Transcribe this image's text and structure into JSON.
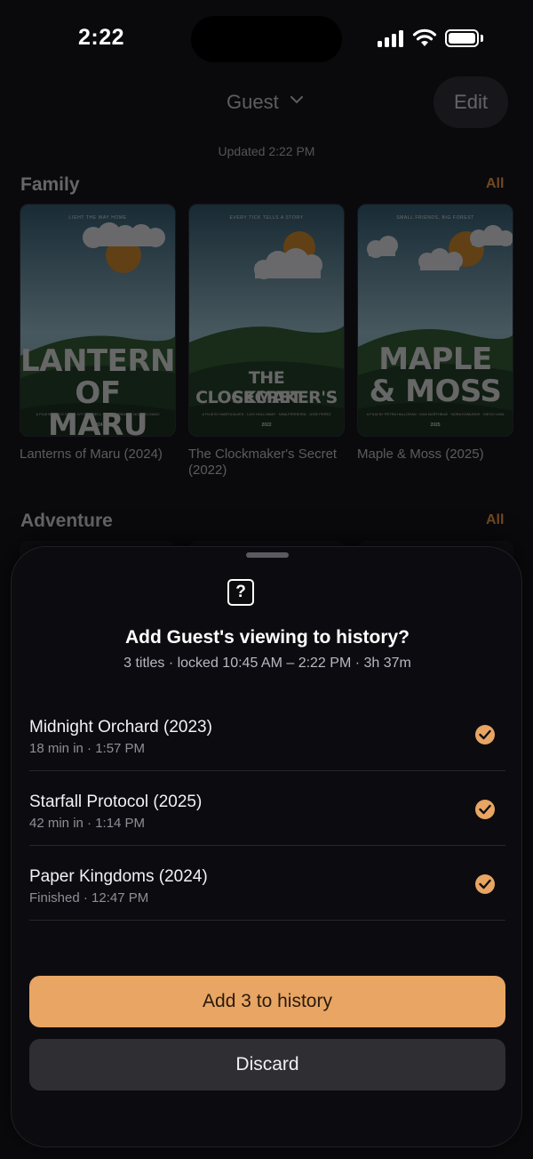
{
  "status_bar": {
    "time": "2:22"
  },
  "header": {
    "profile": "Guest",
    "edit_label": "Edit",
    "updated": "Updated 2:22 PM"
  },
  "sections": [
    {
      "title": "Family",
      "all_label": "All",
      "posters": [
        {
          "tagline": "LIGHT THE WAY HOME",
          "title_line1": "LANTERNS",
          "title_line2": "OF MARU",
          "credits": "A FILM BY HAYO SATO · IVY ROSWELL · OAK FAIRBURY · NOA DELGADO",
          "year": "2024",
          "caption": "Lanterns of Maru (2024)"
        },
        {
          "tagline": "EVERY TICK TELLS A STORY",
          "title_line1": "THE CLOCKMAKER'S",
          "title_line2": "SECRET",
          "credits": "A FILM BY MARTA ALVES · LUIS HOLLOWAY · NINA FERREIRA · JOSE PEREZ",
          "year": "2022",
          "caption": "The Clockmaker's Secret (2022)"
        },
        {
          "tagline": "SMALL FRIENDS, BIG FOREST",
          "title_line1": "MAPLE",
          "title_line2": "& MOSS",
          "credits": "A FILM BY PETRA HALLORAN · DAN NORTHBUE · NORA EDMUNDS · DIEGO LIMA",
          "year": "2025",
          "caption": "Maple & Moss (2025)"
        }
      ]
    },
    {
      "title": "Adventure",
      "all_label": "All"
    }
  ],
  "sheet": {
    "title": "Add Guest's viewing to history?",
    "subtitle": "3 titles · locked 10:45 AM – 2:22 PM · 3h 37m",
    "items": [
      {
        "title": "Midnight Orchard (2023)",
        "meta": "18 min in · 1:57 PM",
        "checked": true
      },
      {
        "title": "Starfall Protocol (2025)",
        "meta": "42 min in · 1:14 PM",
        "checked": true
      },
      {
        "title": "Paper Kingdoms (2024)",
        "meta": "Finished · 12:47 PM",
        "checked": true
      }
    ],
    "primary_label": "Add 3 to history",
    "secondary_label": "Discard"
  },
  "colors": {
    "accent": "#e8a563",
    "background": "#0a0a0d",
    "sheet": "#0c0c10"
  }
}
